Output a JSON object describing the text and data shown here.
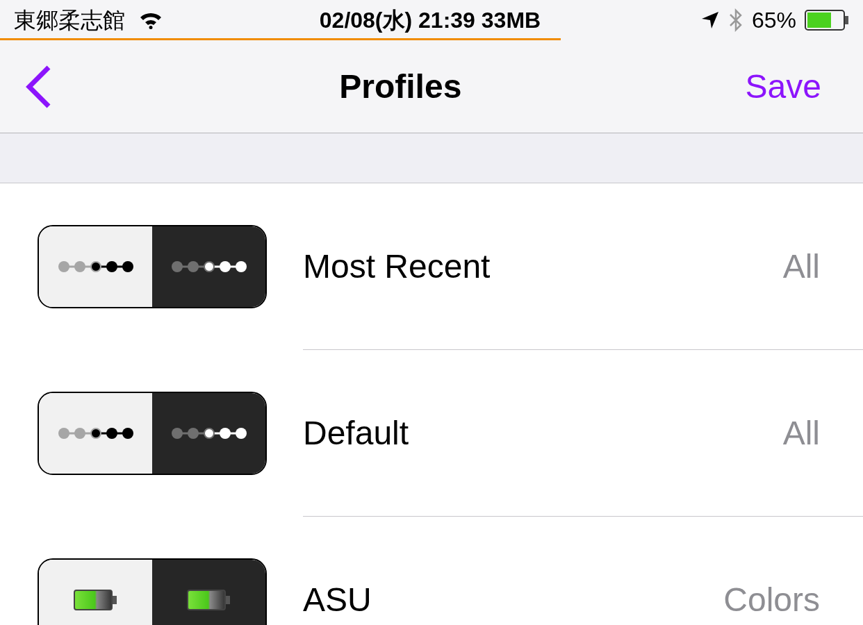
{
  "status_bar": {
    "carrier": "東郷柔志館",
    "center": "02/08(水) 21:39 33MB",
    "battery": "65%",
    "level": 0.65
  },
  "nav": {
    "title": "Profiles",
    "action": "Save"
  },
  "rows": [
    {
      "kind": "dots",
      "title": "Most Recent",
      "value": "All"
    },
    {
      "kind": "dots",
      "title": "Default",
      "value": "All"
    },
    {
      "kind": "battery",
      "title": "ASU",
      "value": "Colors"
    }
  ]
}
